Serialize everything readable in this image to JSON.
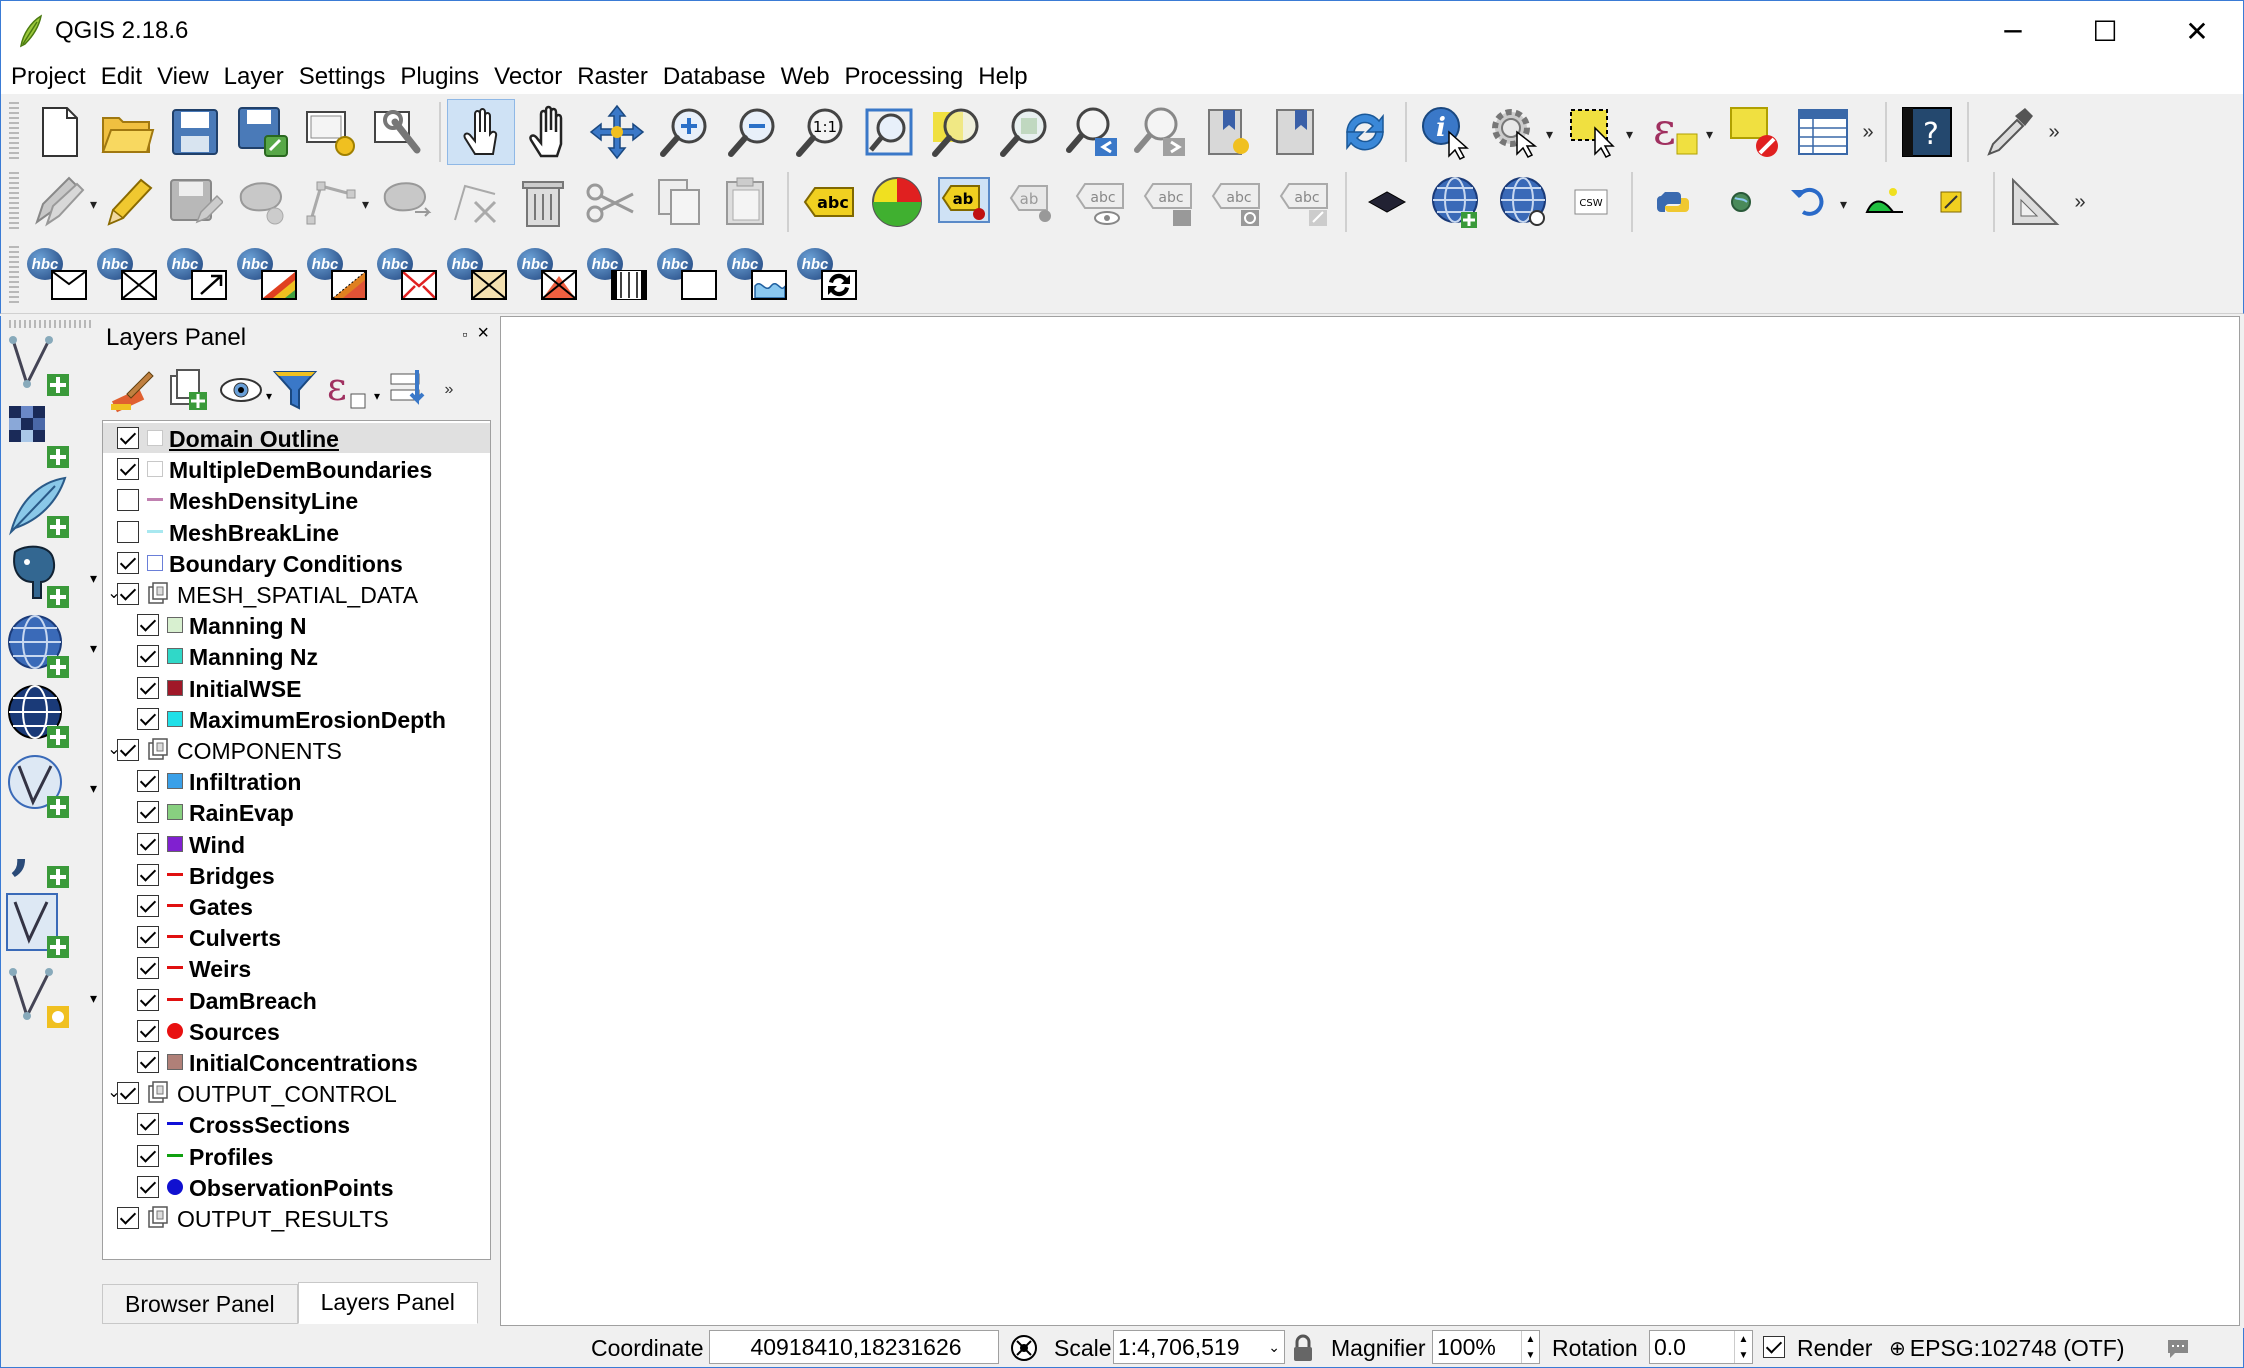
{
  "window": {
    "title": "QGIS 2.18.6",
    "minimize": "─",
    "maximize": "☐",
    "close": "✕"
  },
  "menu": [
    "Project",
    "Edit",
    "View",
    "Layer",
    "Settings",
    "Plugins",
    "Vector",
    "Raster",
    "Database",
    "Web",
    "Processing",
    "Help"
  ],
  "toolbar": {
    "csw_label": "CSW",
    "abc": "abc",
    "ab": "ab",
    "help_label": "?"
  },
  "hbc_label": "hbc",
  "layers_panel": {
    "title": "Layers Panel",
    "float_btn": "▫",
    "close_btn": "×",
    "more": "»",
    "tabs": [
      "Browser Panel",
      "Layers Panel"
    ],
    "layers": [
      {
        "name": "Domain Outline",
        "checked": true,
        "level": 0,
        "symbol": "outline-gray",
        "selected": true,
        "underline": true,
        "bold": true
      },
      {
        "name": "MultipleDemBoundaries",
        "checked": true,
        "level": 0,
        "symbol": "outline-gray",
        "bold": true
      },
      {
        "name": "MeshDensityLine",
        "checked": false,
        "level": 0,
        "symbol": "line-pink",
        "bold": true
      },
      {
        "name": "MeshBreakLine",
        "checked": false,
        "level": 0,
        "symbol": "line-cyan",
        "bold": true
      },
      {
        "name": "Boundary Conditions",
        "checked": true,
        "level": 0,
        "symbol": "outline-blue",
        "bold": true
      },
      {
        "name": "MESH_SPATIAL_DATA",
        "checked": true,
        "level": 0,
        "group": true,
        "expanded": true
      },
      {
        "name": "Manning N",
        "checked": true,
        "level": 1,
        "symbol": "fill-lightgreen",
        "bold": true
      },
      {
        "name": "Manning Nz",
        "checked": true,
        "level": 1,
        "symbol": "fill-cyan",
        "bold": true
      },
      {
        "name": "InitialWSE",
        "checked": true,
        "level": 1,
        "symbol": "fill-darkred",
        "bold": true
      },
      {
        "name": "MaximumErosionDepth",
        "checked": true,
        "level": 1,
        "symbol": "fill-aqua",
        "bold": true
      },
      {
        "name": "COMPONENTS",
        "checked": true,
        "level": 0,
        "group": true,
        "expanded": true
      },
      {
        "name": "Infiltration",
        "checked": true,
        "level": 1,
        "symbol": "fill-blue",
        "bold": true
      },
      {
        "name": "RainEvap",
        "checked": true,
        "level": 1,
        "symbol": "fill-green",
        "bold": true
      },
      {
        "name": "Wind",
        "checked": true,
        "level": 1,
        "symbol": "fill-purple",
        "bold": true
      },
      {
        "name": "Bridges",
        "checked": true,
        "level": 1,
        "symbol": "line-red",
        "bold": true
      },
      {
        "name": "Gates",
        "checked": true,
        "level": 1,
        "symbol": "line-red",
        "bold": true
      },
      {
        "name": "Culverts",
        "checked": true,
        "level": 1,
        "symbol": "line-red",
        "bold": true
      },
      {
        "name": "Weirs",
        "checked": true,
        "level": 1,
        "symbol": "line-red",
        "bold": true
      },
      {
        "name": "DamBreach",
        "checked": true,
        "level": 1,
        "symbol": "line-red",
        "bold": true
      },
      {
        "name": "Sources",
        "checked": true,
        "level": 1,
        "symbol": "point-red",
        "bold": true
      },
      {
        "name": "InitialConcentrations",
        "checked": true,
        "level": 1,
        "symbol": "fill-tan",
        "bold": true
      },
      {
        "name": "OUTPUT_CONTROL",
        "checked": true,
        "level": 0,
        "group": true,
        "expanded": true
      },
      {
        "name": "CrossSections",
        "checked": true,
        "level": 1,
        "symbol": "line-blue",
        "bold": true
      },
      {
        "name": "Profiles",
        "checked": true,
        "level": 1,
        "symbol": "line-green",
        "bold": true
      },
      {
        "name": "ObservationPoints",
        "checked": true,
        "level": 1,
        "symbol": "point-blue",
        "bold": true
      },
      {
        "name": "OUTPUT_RESULTS",
        "checked": true,
        "level": 0,
        "group": true,
        "expanded": false
      }
    ]
  },
  "status": {
    "coordinate_label": "Coordinate",
    "coordinate_value": "40918410,18231626",
    "scale_label": "Scale",
    "scale_value": "1:4,706,519",
    "magnifier_label": "Magnifier",
    "magnifier_value": "100%",
    "rotation_label": "Rotation",
    "rotation_value": "0.0",
    "render_label": "Render",
    "render_checked": true,
    "crs": "EPSG:102748 (OTF)"
  },
  "colors": {
    "outline-gray": "#c8c8c8",
    "outline-blue": "#6a7fd8",
    "line-pink": "#c080b0",
    "line-cyan": "#a8e8f0",
    "fill-lightgreen": "#d8f0d0",
    "fill-cyan": "#30d8c8",
    "fill-darkred": "#a01828",
    "fill-aqua": "#20e0e8",
    "fill-blue": "#3aa0e8",
    "fill-green": "#88d080",
    "fill-purple": "#8020d0",
    "line-red": "#e01010",
    "point-red": "#e81010",
    "fill-tan": "#b08078",
    "line-blue": "#1010d8",
    "line-green": "#10a010",
    "point-blue": "#1010d0"
  }
}
